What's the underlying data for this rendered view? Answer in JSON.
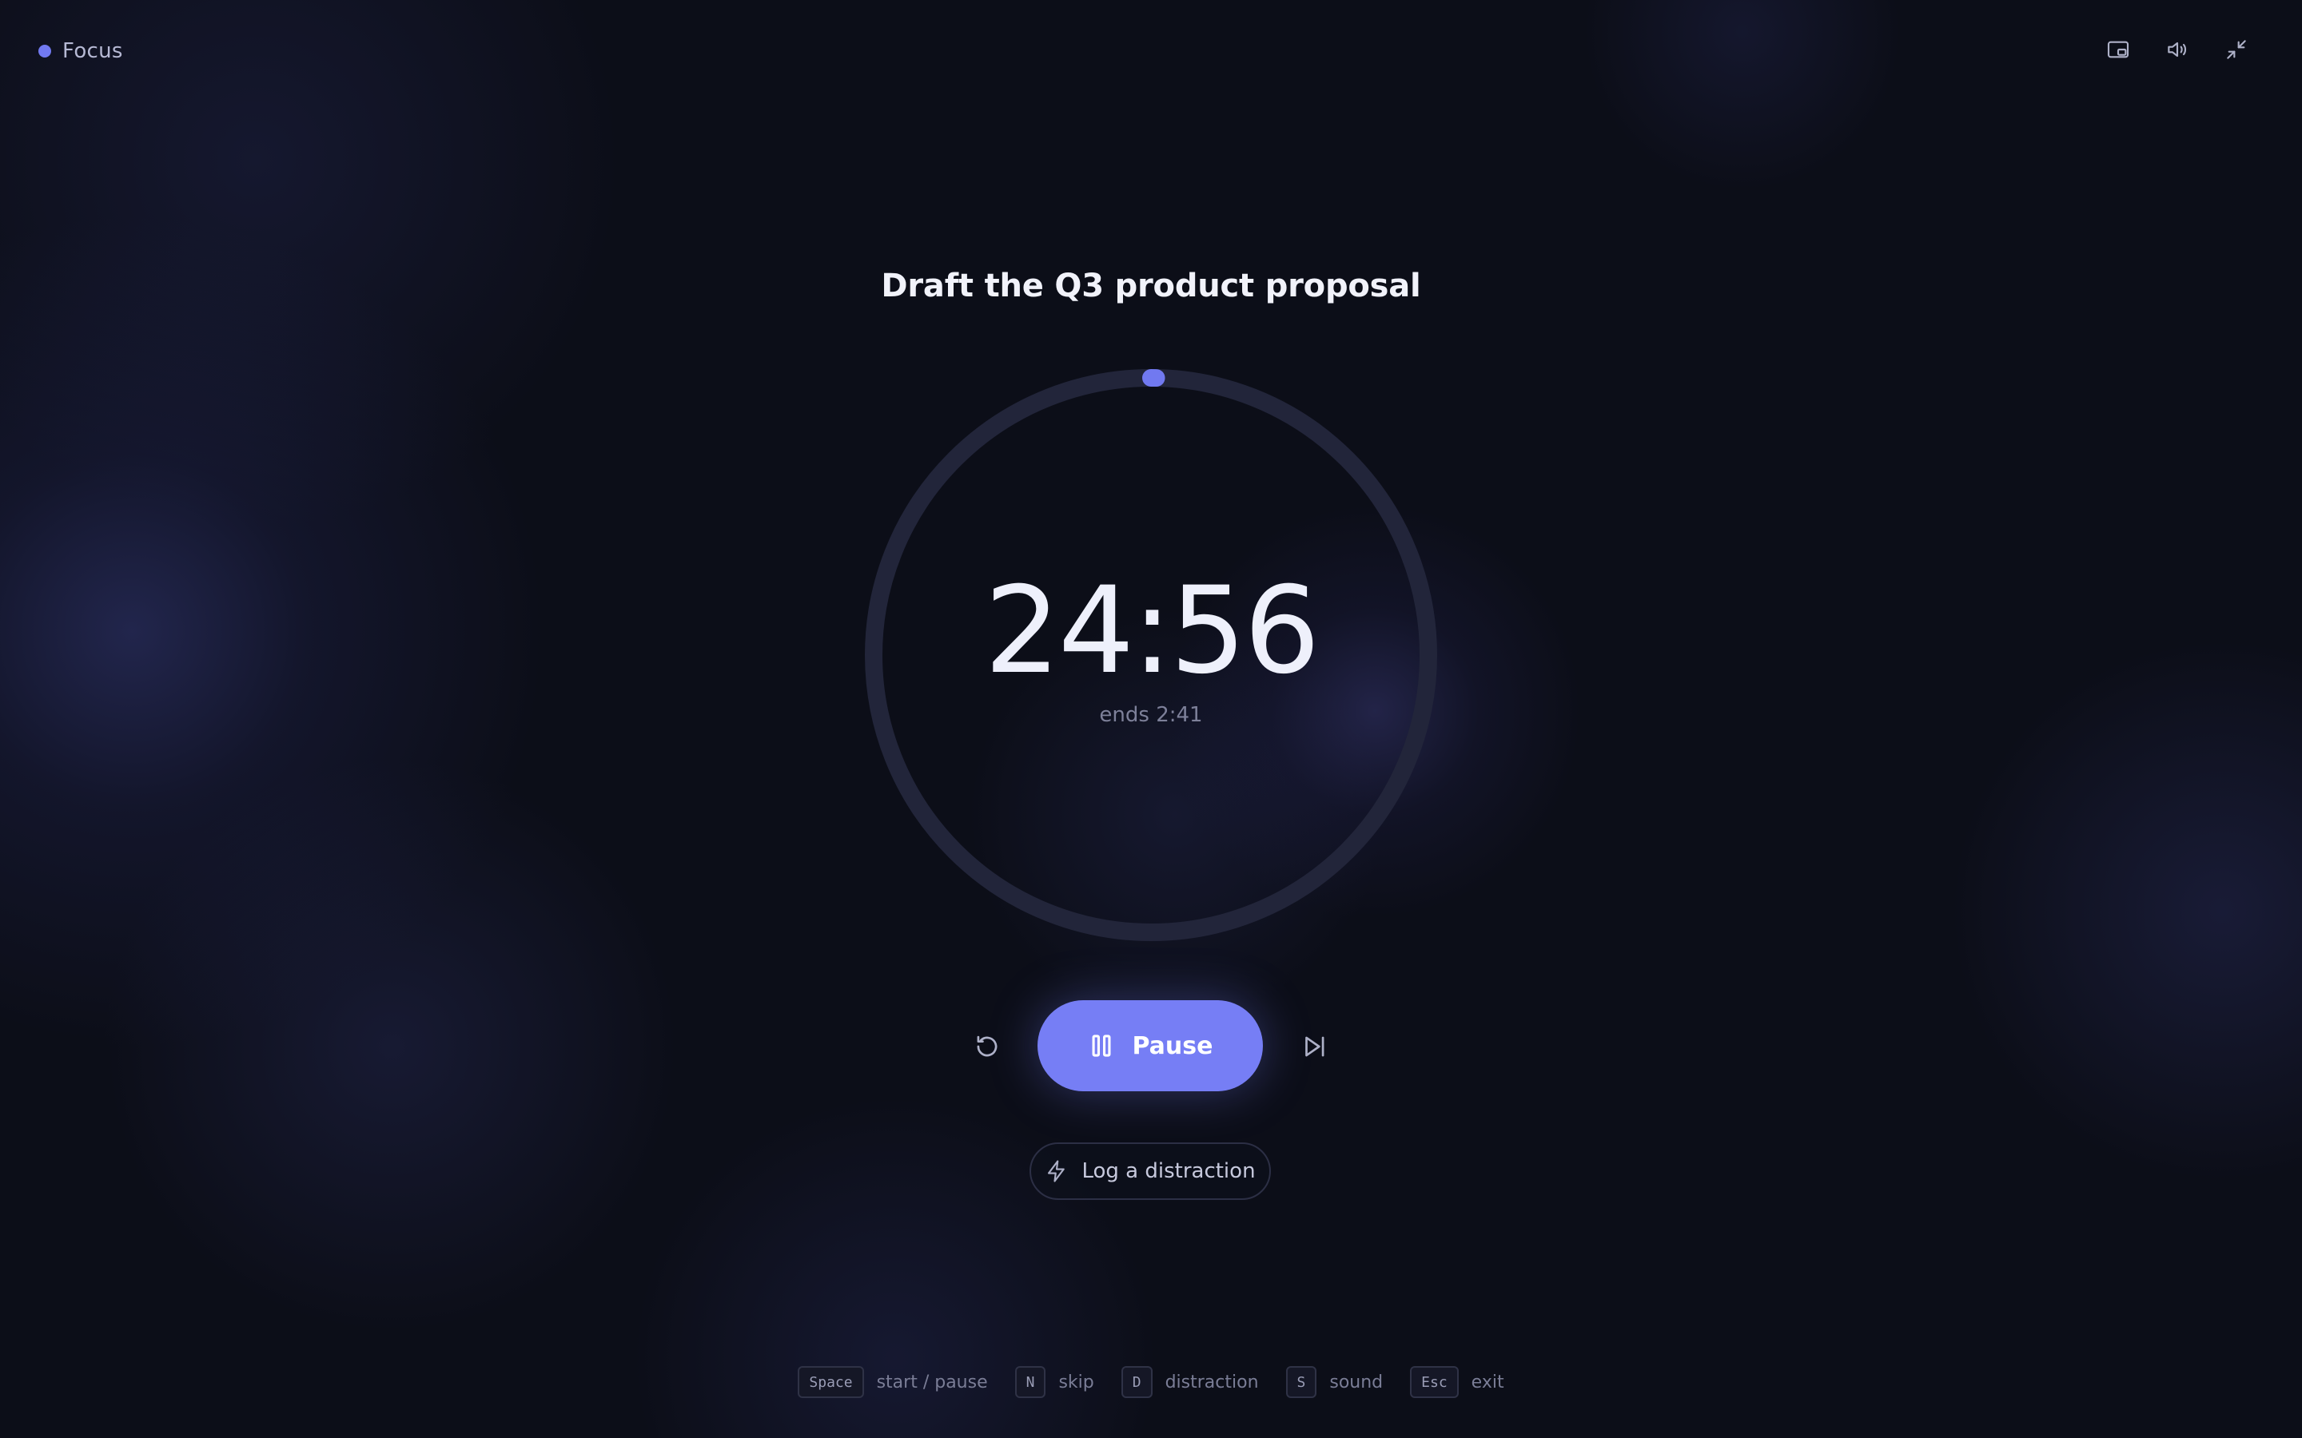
{
  "mode": {
    "label": "Focus",
    "dot_color": "#7179f0"
  },
  "window_controls": [
    {
      "name": "picture-in-picture-icon",
      "label": ""
    },
    {
      "name": "volume-icon",
      "label": ""
    },
    {
      "name": "minimize-icon",
      "label": ""
    }
  ],
  "session": {
    "task_title": "Draft the Q3 product proposal",
    "time_remaining": "24:56",
    "ends_at": "ends 2:41",
    "progress": 0.003
  },
  "controls": {
    "reset_icon": "reset-icon",
    "pause_label": "Pause",
    "pause_icon": "pause-icon",
    "skip_icon": "skip-next-icon",
    "accent_color": "#767ef5"
  },
  "distraction": {
    "label": "Log a distraction",
    "icon": "lightning-icon"
  },
  "shortcuts": [
    {
      "key": "Space",
      "label": "start / pause"
    },
    {
      "key": "N",
      "label": "skip"
    },
    {
      "key": "D",
      "label": "distraction"
    },
    {
      "key": "S",
      "label": "sound"
    },
    {
      "key": "Esc",
      "label": "exit"
    }
  ]
}
